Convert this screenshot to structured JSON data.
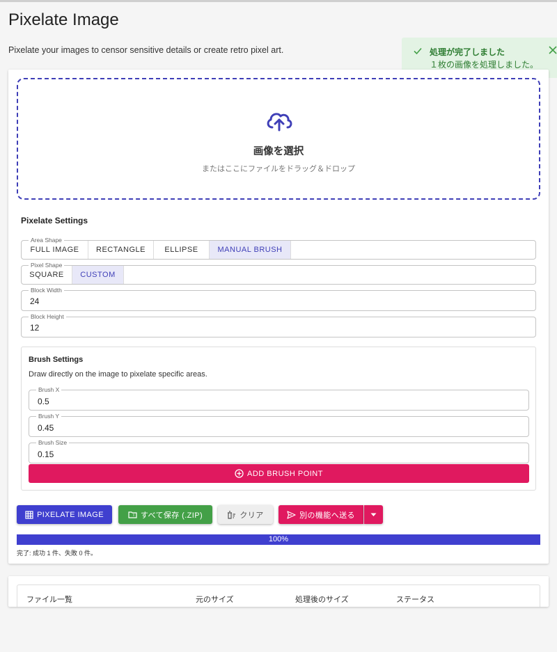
{
  "page": {
    "title": "Pixelate Image",
    "subtitle": "Pixelate your images to censor sensitive details or create retro pixel art."
  },
  "toast": {
    "title": "処理が完了しました",
    "message": "１枚の画像を処理しました。",
    "color": "#2e7d32",
    "icon": "check-icon"
  },
  "dropzone": {
    "title": "画像を選択",
    "subtitle": "またはここにファイルをドラッグ＆ドロップ",
    "icon": "cloud-upload-icon"
  },
  "settings": {
    "title": "Pixelate Settings",
    "area_shape": {
      "label": "Area Shape",
      "options": [
        "FULL IMAGE",
        "RECTANGLE",
        "ELLIPSE",
        "MANUAL BRUSH"
      ],
      "selected": "MANUAL BRUSH"
    },
    "pixel_shape": {
      "label": "Pixel Shape",
      "options": [
        "SQUARE",
        "CUSTOM"
      ],
      "selected": "CUSTOM"
    },
    "block_width": {
      "label": "Block Width",
      "value": "24"
    },
    "block_height": {
      "label": "Block Height",
      "value": "12"
    }
  },
  "brush": {
    "title": "Brush Settings",
    "description": "Draw directly on the image to pixelate specific areas.",
    "x": {
      "label": "Brush X",
      "value": "0.5"
    },
    "y": {
      "label": "Brush Y",
      "value": "0.45"
    },
    "size": {
      "label": "Brush Size",
      "value": "0.15"
    },
    "add_label": "ADD BRUSH POINT"
  },
  "actions": {
    "pixelate": "PIXELATE IMAGE",
    "save_zip": "すべて保存 (.ZIP)",
    "clear": "クリア",
    "send": "別の機能へ送る"
  },
  "progress": {
    "value": 100,
    "label": "100%",
    "status": "完了: 成功 1 件、失敗 0 件。"
  },
  "file_table": {
    "headers": [
      "ファイル一覧",
      "元のサイズ",
      "処理後のサイズ",
      "ステータス"
    ]
  },
  "colors": {
    "primary": "#3f3fcf",
    "accent": "#e0195f",
    "success": "#43a047"
  }
}
